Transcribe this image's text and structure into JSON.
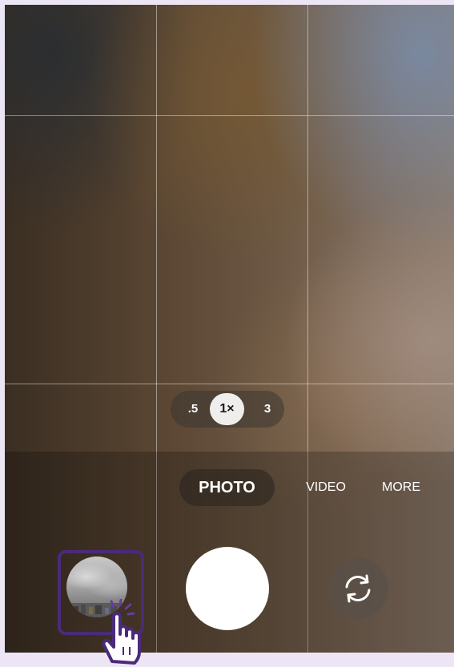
{
  "zoom": {
    "options": [
      ".5",
      "1×",
      "3"
    ],
    "selected": "1×"
  },
  "modes": {
    "photo": "PHOTO",
    "video": "VIDEO",
    "more": "MORE",
    "selected": "PHOTO"
  },
  "icons": {
    "gallery": "gallery-thumbnail",
    "shutter": "shutter-button",
    "flip": "flip-camera-icon",
    "pointer": "tap-hand-icon"
  },
  "colors": {
    "highlight": "#4b2a7a",
    "zoom_active_bg": "#efeeec",
    "background": "#ece6f4"
  }
}
